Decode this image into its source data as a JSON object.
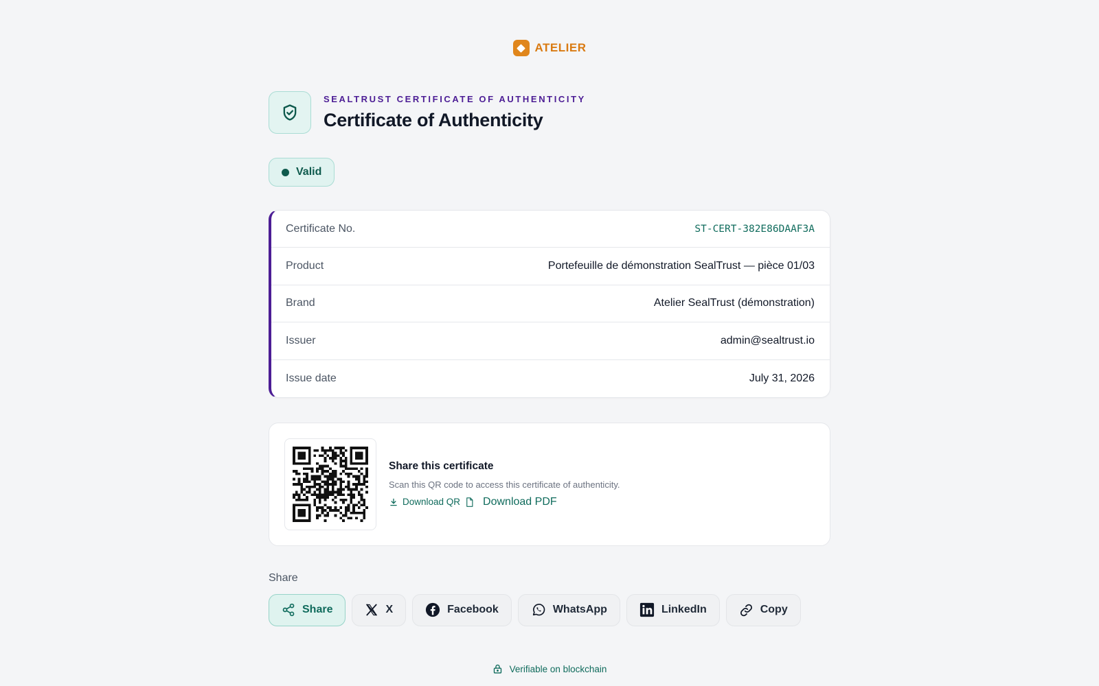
{
  "brand": {
    "name": "ATELIER",
    "color": "#e0861c"
  },
  "header": {
    "eyebrow": "SEALTRUST CERTIFICATE OF AUTHENTICITY",
    "title": "Certificate of Authenticity",
    "icon": "shield-check-icon"
  },
  "status": {
    "label": "Valid",
    "color": "#0f5a4d"
  },
  "details": {
    "accent": "#4c1d95",
    "rows": [
      {
        "key": "Certificate No.",
        "value": "ST-CERT-382E86DAAF3A"
      },
      {
        "key": "Product",
        "value": "Portefeuille de démonstration SealTrust — pièce 01/03"
      },
      {
        "key": "Brand",
        "value": "Atelier SealTrust (démonstration)"
      },
      {
        "key": "Issuer",
        "value": "admin@sealtrust.io"
      },
      {
        "key": "Issue date",
        "value": "July 31, 2026"
      }
    ]
  },
  "qr": {
    "heading": "Share this certificate",
    "description": "Scan this QR code to access this certificate of authenticity.",
    "download_qr": "Download QR",
    "download_pdf": "Download PDF"
  },
  "share": {
    "label": "Share",
    "buttons": [
      {
        "label": "Share",
        "icon": "share-icon"
      },
      {
        "label": "X",
        "icon": "x-logo-icon"
      },
      {
        "label": "Facebook",
        "icon": "facebook-icon"
      },
      {
        "label": "WhatsApp",
        "icon": "whatsapp-icon"
      },
      {
        "label": "LinkedIn",
        "icon": "linkedin-icon"
      },
      {
        "label": "Copy",
        "icon": "link-icon"
      }
    ]
  },
  "footer": {
    "verify": "Verifiable on blockchain",
    "icon": "lock-icon"
  }
}
